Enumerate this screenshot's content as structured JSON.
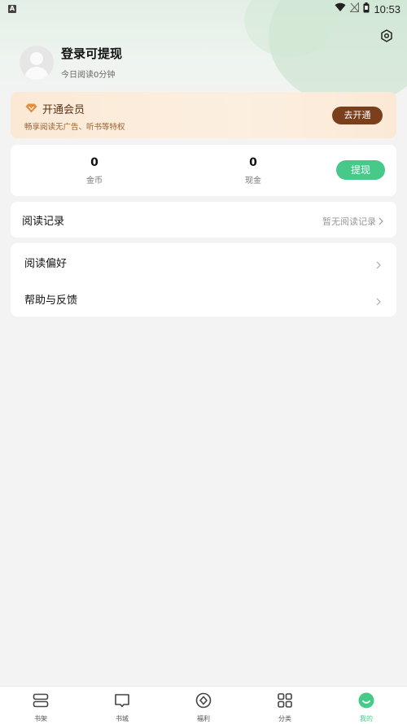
{
  "status_bar": {
    "time": "10:53",
    "left_icon": "A",
    "icons": [
      "wifi-icon",
      "signal-off-icon",
      "battery-icon"
    ]
  },
  "header": {
    "settings_icon": "gear-icon"
  },
  "profile": {
    "name": "登录可提现",
    "subtitle": "今日阅读0分钟",
    "avatar_icon": "avatar-placeholder-icon"
  },
  "vip": {
    "title": "开通会员",
    "subtitle": "畅享阅读无广告、听书等特权",
    "button_label": "去开通",
    "icon": "diamond-icon"
  },
  "wallet": {
    "coins_value": "0",
    "coins_label": "金币",
    "cash_value": "0",
    "cash_label": "现金",
    "withdraw_label": "提现"
  },
  "reading_record": {
    "title": "阅读记录",
    "status": "暂无阅读记录"
  },
  "menu": {
    "items": [
      {
        "label": "阅读偏好"
      },
      {
        "label": "帮助与反馈"
      }
    ]
  },
  "tabbar": {
    "tabs": [
      {
        "label": "书架",
        "icon": "bookshelf-icon",
        "active": false
      },
      {
        "label": "书城",
        "icon": "book-open-icon",
        "active": false
      },
      {
        "label": "福利",
        "icon": "welfare-icon",
        "active": false
      },
      {
        "label": "分类",
        "icon": "grid-icon",
        "active": false
      },
      {
        "label": "我的",
        "icon": "profile-face-icon",
        "active": true
      }
    ]
  },
  "colors": {
    "accent": "#47c98a",
    "vip_button": "#7a3f1c",
    "background": "#f3f3f3"
  }
}
